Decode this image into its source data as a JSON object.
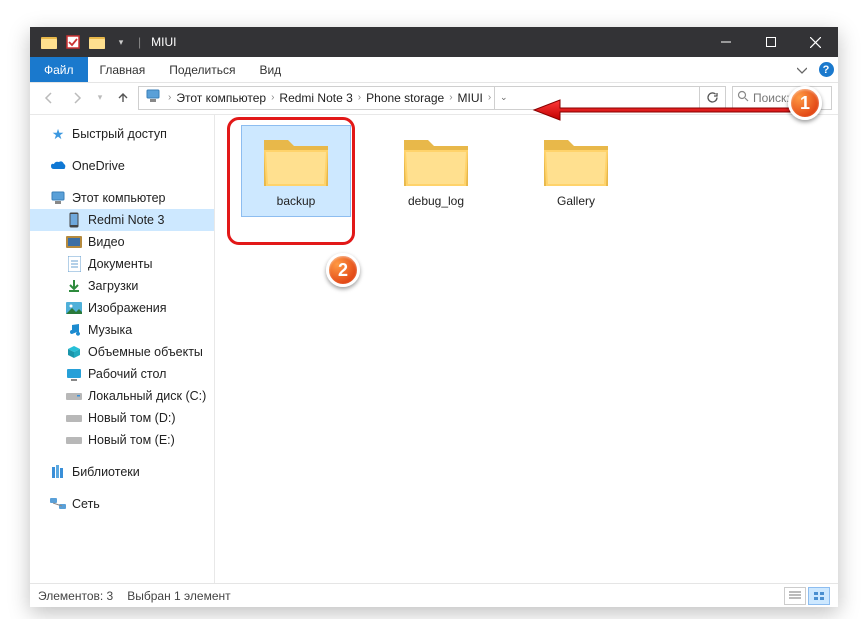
{
  "titlebar": {
    "title": "MIUI"
  },
  "ribbon": {
    "file": "Файл",
    "tabs": [
      "Главная",
      "Поделиться",
      "Вид"
    ]
  },
  "breadcrumbs": [
    "Этот компьютер",
    "Redmi Note 3",
    "Phone storage",
    "MIUI"
  ],
  "search": {
    "placeholder": "Поиск: M..."
  },
  "sidebar": {
    "quick_access": "Быстрый доступ",
    "onedrive": "OneDrive",
    "this_pc": "Этот компьютер",
    "items": [
      {
        "label": "Redmi Note 3",
        "icon": "phone"
      },
      {
        "label": "Видео",
        "icon": "video"
      },
      {
        "label": "Документы",
        "icon": "docs"
      },
      {
        "label": "Загрузки",
        "icon": "downloads"
      },
      {
        "label": "Изображения",
        "icon": "pictures"
      },
      {
        "label": "Музыка",
        "icon": "music"
      },
      {
        "label": "Объемные объекты",
        "icon": "3d"
      },
      {
        "label": "Рабочий стол",
        "icon": "desktop"
      },
      {
        "label": "Локальный диск (C:)",
        "icon": "drive"
      },
      {
        "label": "Новый том (D:)",
        "icon": "drive"
      },
      {
        "label": "Новый том (E:)",
        "icon": "drive"
      }
    ],
    "libraries": "Библиотеки",
    "network": "Сеть"
  },
  "folders": [
    {
      "name": "backup",
      "selected": true
    },
    {
      "name": "debug_log",
      "selected": false
    },
    {
      "name": "Gallery",
      "selected": false
    }
  ],
  "statusbar": {
    "count": "Элементов: 3",
    "selected": "Выбран 1 элемент"
  },
  "annotations": {
    "badge1": "1",
    "badge2": "2"
  }
}
